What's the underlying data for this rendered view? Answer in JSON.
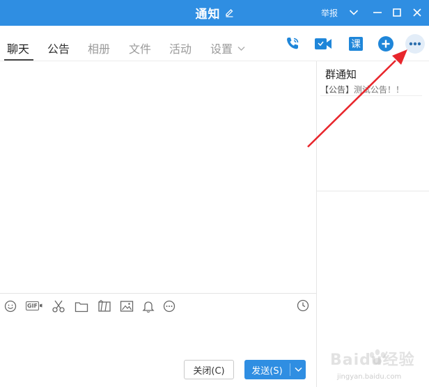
{
  "titlebar": {
    "title": "通知",
    "report": "举报"
  },
  "tabs": [
    {
      "label": "聊天"
    },
    {
      "label": "公告"
    },
    {
      "label": "相册"
    },
    {
      "label": "文件"
    },
    {
      "label": "活动"
    },
    {
      "label": "设置"
    }
  ],
  "toolbar_icons": {
    "class_label": "课"
  },
  "panel": {
    "title": "群通知",
    "notice_prefix": "【公告】",
    "notice_text": "测试公告！！"
  },
  "input": {
    "gif_label": "GIF"
  },
  "buttons": {
    "close": "关闭(C)",
    "send": "发送(S)"
  },
  "watermark": {
    "brand": "Baidu经验",
    "url": "jingyan.baidu.com"
  },
  "colors": {
    "accent": "#2f8ee2",
    "annotation": "#e8262c"
  }
}
